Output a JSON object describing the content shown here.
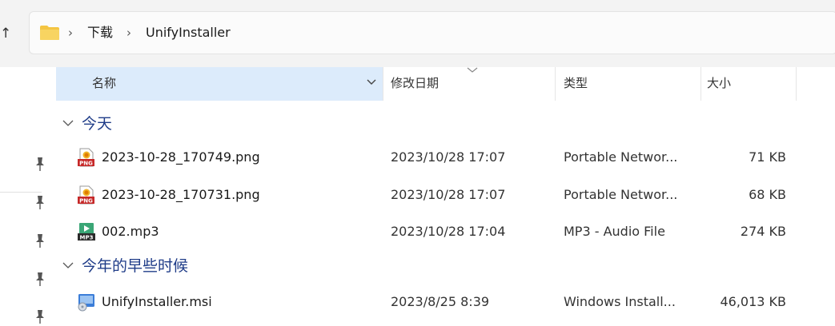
{
  "navigation": {
    "up_icon": "arrow-up-icon",
    "up_glyph": "↑"
  },
  "address_bar": {
    "folder_icon": "folder-icon",
    "separator": "›",
    "crumbs": [
      "下载",
      "UnifyInstaller"
    ]
  },
  "columns": {
    "name": "名称",
    "date_modified": "修改日期",
    "type": "类型",
    "size": "大小",
    "sorted_by": "修改日期",
    "sort_direction": "descending"
  },
  "groups": [
    {
      "title": "今天",
      "expanded": true,
      "files": [
        {
          "icon": "png-file-icon",
          "name": "2023-10-28_170749.png",
          "date": "2023/10/28 17:07",
          "type": "Portable Networ...",
          "size": "71 KB"
        },
        {
          "icon": "png-file-icon",
          "name": "2023-10-28_170731.png",
          "date": "2023/10/28 17:07",
          "type": "Portable Networ...",
          "size": "68 KB"
        },
        {
          "icon": "mp3-file-icon",
          "name": "002.mp3",
          "date": "2023/10/28 17:04",
          "type": "MP3 - Audio File",
          "size": "274 KB"
        }
      ]
    },
    {
      "title": "今年的早些时候",
      "expanded": true,
      "files": [
        {
          "icon": "msi-file-icon",
          "name": "UnifyInstaller.msi",
          "date": "2023/8/25 8:39",
          "type": "Windows Install...",
          "size": "46,013 KB"
        }
      ]
    }
  ],
  "sidebar": {
    "pin_icon": "pin-icon",
    "pinned_count": 5
  },
  "colors": {
    "header_highlight": "#dcebfb",
    "group_title": "#1f3c88",
    "folder": "#f4c542"
  }
}
